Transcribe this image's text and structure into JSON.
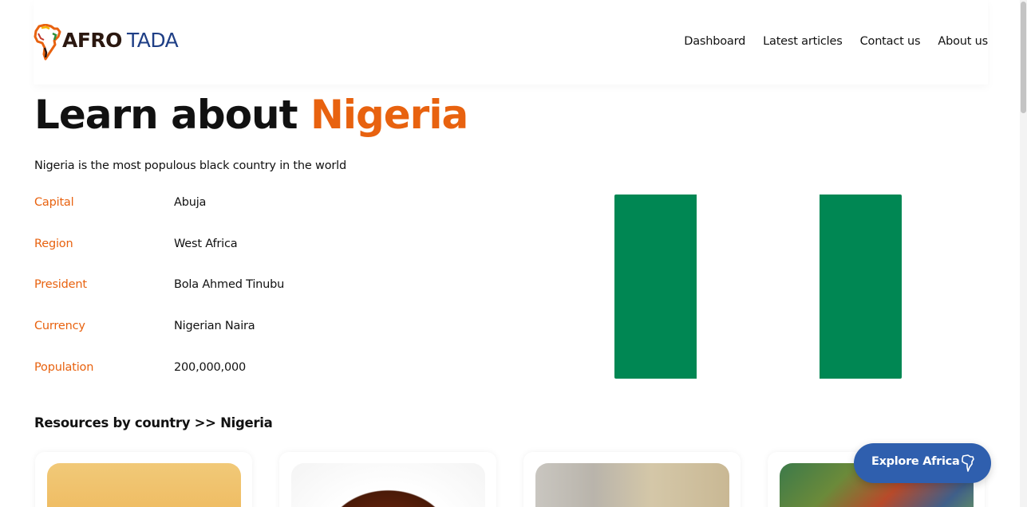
{
  "brand": {
    "logo_part1": "AFRO",
    "logo_part2": "TADA",
    "colors": {
      "accent": "#e8620f",
      "primary_blue": "#2f5fae",
      "flag_green": "#008753"
    }
  },
  "nav": {
    "items": [
      {
        "label": "Dashboard"
      },
      {
        "label": "Latest articles"
      },
      {
        "label": "Contact us"
      },
      {
        "label": "About us"
      }
    ]
  },
  "hero": {
    "title_prefix": "Learn about",
    "title_country": "Nigeria",
    "subtitle": "Nigeria is the most populous black country in the world"
  },
  "facts": [
    {
      "label": "Capital",
      "value": "Abuja"
    },
    {
      "label": "Region",
      "value": "West Africa"
    },
    {
      "label": "President",
      "value": "Bola Ahmed Tinubu"
    },
    {
      "label": "Currency",
      "value": "Nigerian Naira"
    },
    {
      "label": "Population",
      "value": "200,000,000"
    }
  ],
  "flag": {
    "icon": "nigeria-flag",
    "colors": [
      "#008753",
      "#ffffff",
      "#008753"
    ]
  },
  "resources": {
    "heading": "Resources by country >> Nigeria",
    "cards": [
      {
        "image_icon": "portrait-photo"
      },
      {
        "image_icon": "food-dish-photo"
      },
      {
        "image_icon": "person-photo"
      },
      {
        "image_icon": "painting-photo"
      }
    ]
  },
  "explore_button": {
    "label": "Explore Africa",
    "icon": "africa-map-icon"
  }
}
